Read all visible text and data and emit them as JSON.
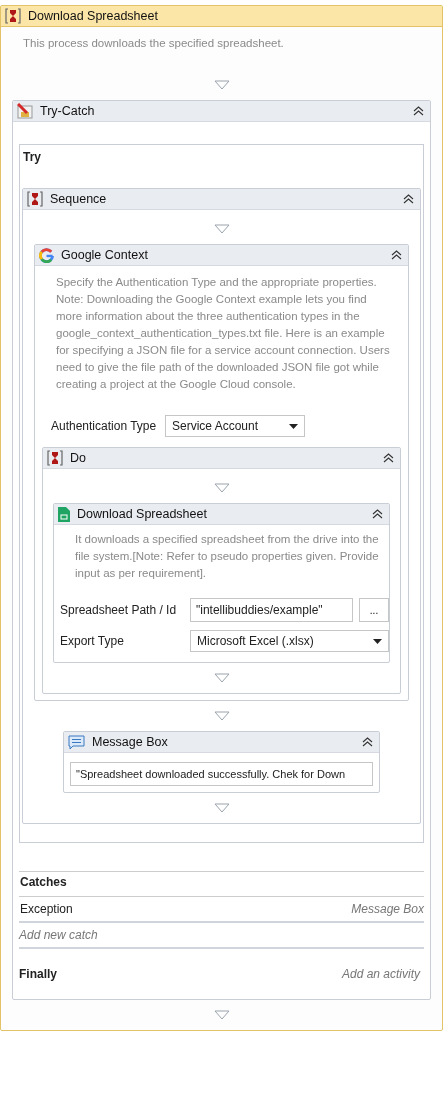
{
  "root": {
    "kind": "sequence",
    "title": "Download Spreadsheet",
    "description": "This process downloads the specified spreadsheet.",
    "children": [
      {
        "kind": "trycatch",
        "title": "Try-Catch",
        "try_label": "Try",
        "children": [
          {
            "kind": "sequence",
            "title": "Sequence",
            "children": [
              {
                "kind": "google",
                "title": "Google Context",
                "description": "Specify the Authentication Type and the appropriate properties. Note: Downloading the Google Context example lets you find more information about the three authentication types in the google_context_authentication_types.txt file. Here is an example for specifying a JSON file for a service account connection. Users need to give the file path of the downloaded JSON file got while creating a project at the Google Cloud console.",
                "properties": [
                  {
                    "kind": "dropdown",
                    "label": "Authentication Type",
                    "value": "Service Account"
                  }
                ],
                "children": [
                  {
                    "kind": "sequence",
                    "title": "Do",
                    "children": [
                      {
                        "kind": "sheet",
                        "title": "Download Spreadsheet",
                        "description": "It downloads a specified spreadsheet from the drive into the file system.[Note: Refer to pseudo properties given. Provide input as per requirement].",
                        "properties": [
                          {
                            "kind": "browse",
                            "label": "Spreadsheet Path / Id",
                            "value": "\"intellibuddies/example\"",
                            "button": "..."
                          },
                          {
                            "kind": "dropdown",
                            "label": "Export Type",
                            "value": "Microsoft Excel (.xlsx)"
                          }
                        ]
                      }
                    ]
                  }
                ]
              },
              {
                "kind": "message",
                "title": "Message Box",
                "properties": [
                  {
                    "kind": "text",
                    "value": "\"Spreadsheet downloaded successfully. Chek for Down"
                  }
                ]
              }
            ]
          }
        ],
        "catches": {
          "label": "Catches",
          "rows": [
            {
              "exception": "Exception",
              "handler": "Message Box"
            }
          ],
          "add_placeholder": "Add new catch"
        },
        "finally": {
          "label": "Finally",
          "placeholder": "Add an activity"
        }
      }
    ]
  }
}
